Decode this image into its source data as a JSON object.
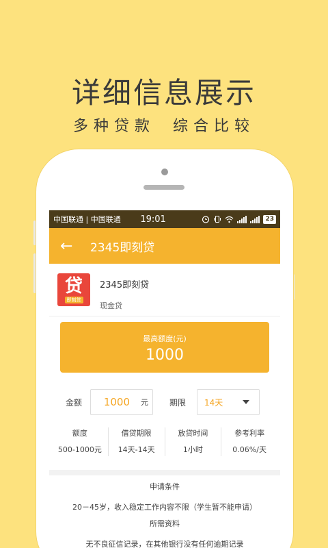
{
  "promo": {
    "headline": "详细信息展示",
    "sub_left": "多种贷款",
    "sub_right": "综合比较"
  },
  "status_bar": {
    "carriers": "中国联通 | 中国联通",
    "time": "19:01",
    "battery": "23"
  },
  "app_bar": {
    "back_icon": "←",
    "title": "2345即刻贷"
  },
  "product": {
    "logo_main": "贷",
    "logo_sub": "即刻贷",
    "name": "2345即刻贷",
    "type": "现金贷"
  },
  "limit": {
    "label": "最高额度(元)",
    "value": "1000"
  },
  "form": {
    "amount_label": "金额",
    "amount_value": "1000",
    "amount_unit": "元",
    "period_label": "期限",
    "period_value": "14天"
  },
  "stats": [
    {
      "header": "额度",
      "value": "500-1000元"
    },
    {
      "header": "借贷期限",
      "value": "14天-14天"
    },
    {
      "header": "放贷时间",
      "value": "1小时"
    },
    {
      "header": "参考利率",
      "value": "0.06%/天"
    }
  ],
  "requirements": {
    "title": "申请条件",
    "text": "20－45岁，收入稳定工作内容不限（学生暂不能申请）",
    "materials_title": "所需资料",
    "materials_text": "无不良征信记录，在其他银行没有任何逾期记录"
  },
  "colors": {
    "background": "#FDE27E",
    "accent": "#F5B32E",
    "status_bar": "#4a3b1a",
    "logo_red": "#E9463B"
  }
}
